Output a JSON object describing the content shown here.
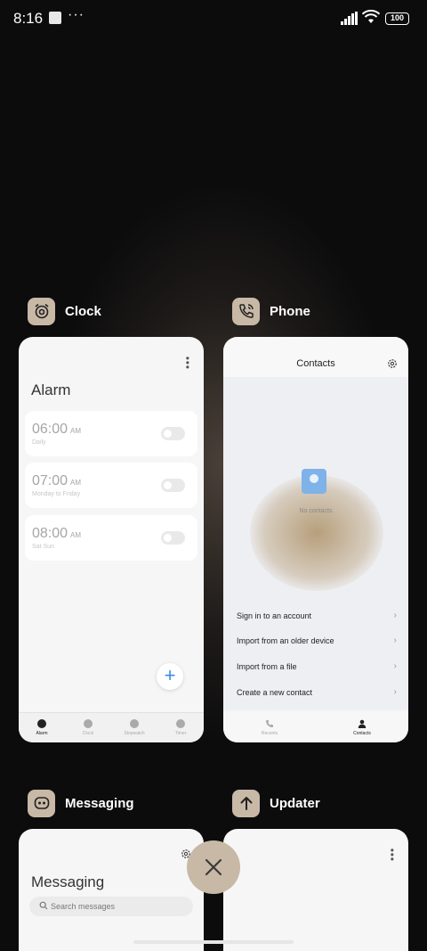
{
  "status_bar": {
    "time": "8:16",
    "dots": "···",
    "battery": "100"
  },
  "apps": {
    "clock": {
      "name": "Clock",
      "screen_title": "Alarm",
      "alarms": [
        {
          "time": "06:00",
          "ampm": "AM",
          "repeat": "Daily"
        },
        {
          "time": "07:00",
          "ampm": "AM",
          "repeat": "Monday to Friday"
        },
        {
          "time": "08:00",
          "ampm": "AM",
          "repeat": "Sat Sun"
        }
      ],
      "nav": [
        "Alarm",
        "Clock",
        "Stopwatch",
        "Timer"
      ]
    },
    "phone": {
      "name": "Phone",
      "screen_title": "Contacts",
      "empty_text": "No contacts",
      "options": [
        "Sign in to an account",
        "Import from an older device",
        "Import from a file",
        "Create a new contact"
      ],
      "nav": [
        "Recents",
        "Contacts"
      ]
    },
    "messaging": {
      "name": "Messaging",
      "screen_title": "Messaging",
      "search_placeholder": "Search messages"
    },
    "updater": {
      "name": "Updater"
    }
  },
  "close_button": "×",
  "colors": {
    "accent": "#c8b8a6",
    "fab_plus": "#3b8ce0",
    "background": "#0c0c0d"
  },
  "icons": {
    "clock": "alarm-clock-icon",
    "phone": "phone-call-icon",
    "messaging": "chat-bubble-icon",
    "updater": "upload-arrow-icon",
    "close": "close-icon"
  }
}
